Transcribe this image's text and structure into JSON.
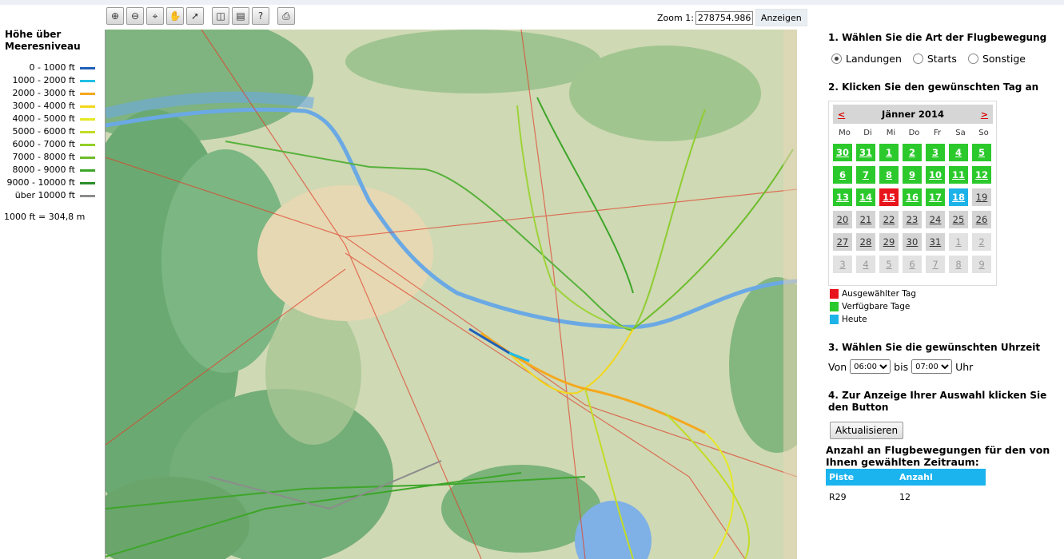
{
  "legend": {
    "title_line1": "Höhe über",
    "title_line2": "Meeresniveau",
    "rows": [
      {
        "label": "0  -  1000  ft",
        "color": "#1f5fb8"
      },
      {
        "label": "1000  -  2000  ft",
        "color": "#20bfe6"
      },
      {
        "label": "2000  -  3000  ft",
        "color": "#f5a81c"
      },
      {
        "label": "3000  -  4000  ft",
        "color": "#f2d71a"
      },
      {
        "label": "4000  -  5000  ft",
        "color": "#e6e823"
      },
      {
        "label": "5000  -  6000  ft",
        "color": "#c3dc26"
      },
      {
        "label": "6000  -  7000  ft",
        "color": "#93cf2a"
      },
      {
        "label": "7000  -  8000  ft",
        "color": "#6cbd2a"
      },
      {
        "label": "8000  -  9000  ft",
        "color": "#3da629"
      },
      {
        "label": "9000  -  10000  ft",
        "color": "#2a8e2a"
      },
      {
        "label": "über  10000  ft",
        "color": "#8c8c8c"
      }
    ],
    "note": "1000 ft = 304,8 m"
  },
  "toolbar": {
    "tools": [
      {
        "name": "zoom-in-tool",
        "glyph": "⊕"
      },
      {
        "name": "zoom-out-tool",
        "glyph": "⊖"
      },
      {
        "name": "zoom-box-tool",
        "glyph": "⌖"
      },
      {
        "name": "pan-hand-tool",
        "glyph": "✋"
      },
      {
        "name": "select-arrow-tool",
        "glyph": "➚"
      },
      {
        "name": "full-extent-tool",
        "glyph": "◫"
      },
      {
        "name": "identify-tool",
        "glyph": "▤"
      },
      {
        "name": "help-tool",
        "glyph": "?"
      },
      {
        "name": "print-tool",
        "glyph": "⎙"
      }
    ],
    "zoom_label": "Zoom 1:",
    "zoom_value": "278754.986",
    "show_button": "Anzeigen"
  },
  "panel": {
    "step1": "1. Wählen Sie die Art  der Flugbewegung",
    "radios": [
      {
        "label": "Landungen",
        "checked": true
      },
      {
        "label": "Starts",
        "checked": false
      },
      {
        "label": "Sonstige",
        "checked": false
      }
    ],
    "step2": "2. Klicken Sie den gewünschten Tag an",
    "calendar": {
      "prev": "<",
      "month": "Jänner 2014",
      "next": ">",
      "weekdays": [
        "Mo",
        "Di",
        "Mi",
        "Do",
        "Fr",
        "Sa",
        "So"
      ],
      "days": [
        {
          "d": "30",
          "s": "av"
        },
        {
          "d": "31",
          "s": "av"
        },
        {
          "d": "1",
          "s": "av"
        },
        {
          "d": "2",
          "s": "av"
        },
        {
          "d": "3",
          "s": "av"
        },
        {
          "d": "4",
          "s": "av"
        },
        {
          "d": "5",
          "s": "av"
        },
        {
          "d": "6",
          "s": "av"
        },
        {
          "d": "7",
          "s": "av"
        },
        {
          "d": "8",
          "s": "av"
        },
        {
          "d": "9",
          "s": "av"
        },
        {
          "d": "10",
          "s": "av"
        },
        {
          "d": "11",
          "s": "av"
        },
        {
          "d": "12",
          "s": "av"
        },
        {
          "d": "13",
          "s": "av"
        },
        {
          "d": "14",
          "s": "av"
        },
        {
          "d": "15",
          "s": "sel"
        },
        {
          "d": "16",
          "s": "av"
        },
        {
          "d": "17",
          "s": "av"
        },
        {
          "d": "18",
          "s": "today"
        },
        {
          "d": "19",
          "s": "gray"
        },
        {
          "d": "20",
          "s": "gray"
        },
        {
          "d": "21",
          "s": "gray"
        },
        {
          "d": "22",
          "s": "gray"
        },
        {
          "d": "23",
          "s": "gray"
        },
        {
          "d": "24",
          "s": "gray"
        },
        {
          "d": "25",
          "s": "gray"
        },
        {
          "d": "26",
          "s": "gray"
        },
        {
          "d": "27",
          "s": "gray"
        },
        {
          "d": "28",
          "s": "gray"
        },
        {
          "d": "29",
          "s": "gray"
        },
        {
          "d": "30",
          "s": "gray"
        },
        {
          "d": "31",
          "s": "gray"
        },
        {
          "d": "1",
          "s": "out"
        },
        {
          "d": "2",
          "s": "out"
        },
        {
          "d": "3",
          "s": "out"
        },
        {
          "d": "4",
          "s": "out"
        },
        {
          "d": "5",
          "s": "out"
        },
        {
          "d": "6",
          "s": "out"
        },
        {
          "d": "7",
          "s": "out"
        },
        {
          "d": "8",
          "s": "out"
        },
        {
          "d": "9",
          "s": "out"
        }
      ]
    },
    "keys": [
      {
        "label": "Ausgewählter Tag",
        "color": "#e8141b"
      },
      {
        "label": "Verfügbare Tage",
        "color": "#2cc92c"
      },
      {
        "label": "Heute",
        "color": "#1db3e8"
      }
    ],
    "step3": "3. Wählen Sie die gewünschten Uhrzeit",
    "time": {
      "from_label": "Von",
      "from": "06:00",
      "to_label": "bis",
      "to": "07:00",
      "unit": "Uhr"
    },
    "step4_line1": "4. Zur Anzeige Ihrer Auswahl klicken Sie",
    "step4_line2": "den Button",
    "update_button": "Aktualisieren",
    "result_line1": "Anzahl an Flugbewegungen für den von",
    "result_line2": "Ihnen gewählten Zeitraum:",
    "table": {
      "headers": [
        "Piste",
        "Anzahl"
      ],
      "rows": [
        [
          "R29",
          "12"
        ]
      ]
    }
  }
}
